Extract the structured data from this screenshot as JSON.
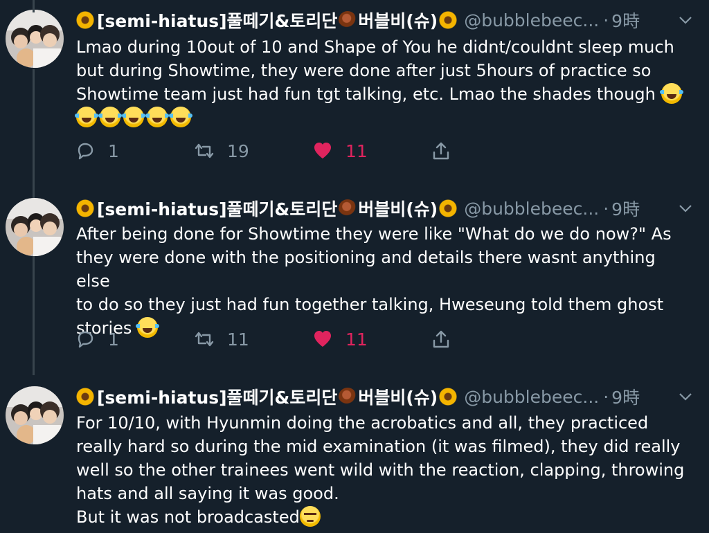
{
  "tweets": [
    {
      "name": "[semi-hiatus]풀떼기&토리단",
      "name_suffix": "버블비(슈)",
      "handle": "@bubblebeec...",
      "dot": "·",
      "time": "9時",
      "lines": [
        "Lmao during 10out of 10 and Shape of You he didnt/couldnt sleep much",
        "but during Showtime, they were done after just 5hours of practice so",
        "Showtime team just had fun tgt talking, etc. Lmao the shades though"
      ],
      "replies": "1",
      "retweets": "19",
      "likes": "11"
    },
    {
      "name": "[semi-hiatus]풀떼기&토리단",
      "name_suffix": "버블비(슈)",
      "handle": "@bubblebeec...",
      "dot": "·",
      "time": "9時",
      "lines": [
        "After being done for Showtime they were like \"What do we do now?\" As",
        "they were done with the positioning and details there wasnt anything else",
        "to do so they just had fun together talking, Hweseung told them ghost",
        "stories"
      ],
      "replies": "1",
      "retweets": "11",
      "likes": "11"
    },
    {
      "name": "[semi-hiatus]풀떼기&토리단",
      "name_suffix": "버블비(슈)",
      "handle": "@bubblebeec...",
      "dot": "·",
      "time": "9時",
      "lines": [
        "For 10/10, with Hyunmin doing the acrobatics and all, they practiced",
        "really hard so during the mid examination (it was filmed), they did really",
        "well so the other trainees went wild with the reaction, clapping, throwing",
        "hats and all saying it was good.",
        "But it was not broadcasted"
      ]
    }
  ],
  "colors": {
    "background": "#15202b",
    "secondary_text": "#8899a6",
    "like_red": "#e0245e",
    "thread_line": "#38444d"
  },
  "icons": [
    "sunflower-emoji",
    "chestnut-emoji",
    "chevron-down-icon",
    "reply-icon",
    "retweet-icon",
    "heart-icon",
    "share-icon",
    "face-with-tears-of-joy-emoji",
    "unamused-face-emoji"
  ]
}
